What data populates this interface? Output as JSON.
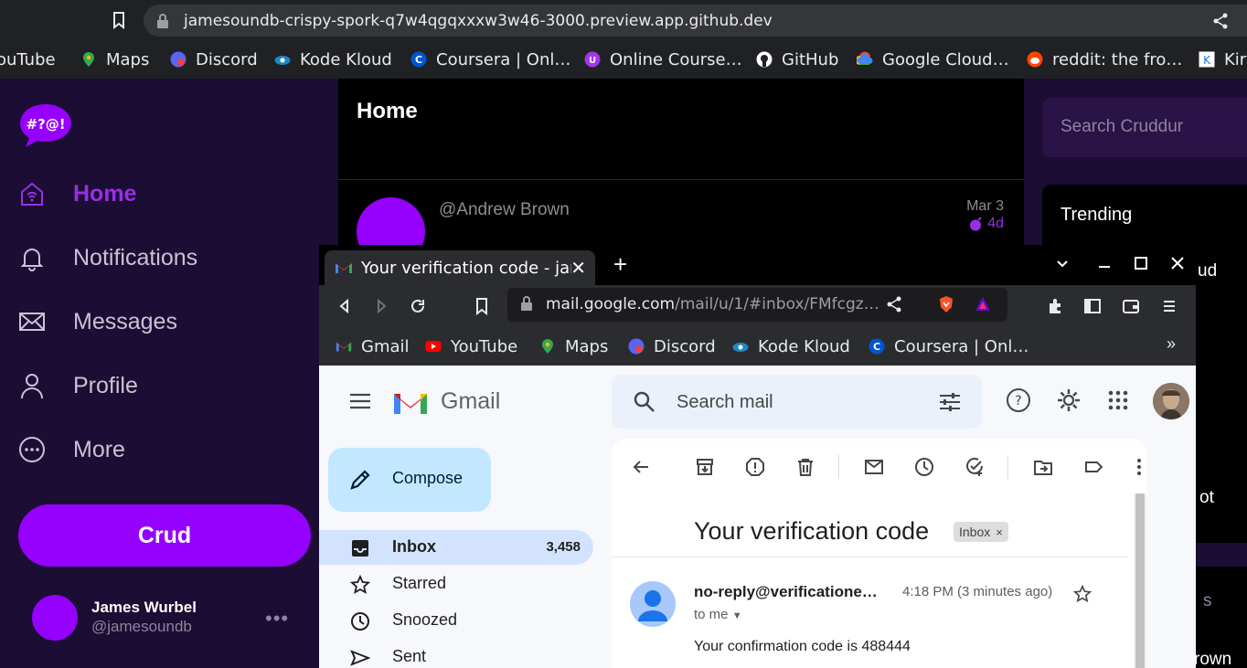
{
  "outer_browser": {
    "url": "jamesoundb-crispy-spork-q7w4qgqxxxw3w46-3000.preview.app.github.dev",
    "bookmarks": [
      {
        "label": "ouTube",
        "icon": "youtube-icon"
      },
      {
        "label": "Maps",
        "icon": "maps-icon"
      },
      {
        "label": "Discord",
        "icon": "discord-icon"
      },
      {
        "label": "Kode Kloud",
        "icon": "kodekloud-icon"
      },
      {
        "label": "Coursera | Onl…",
        "icon": "coursera-icon"
      },
      {
        "label": "Online Course…",
        "icon": "udemy-icon"
      },
      {
        "label": "GitHub",
        "icon": "github-icon"
      },
      {
        "label": "Google Cloud…",
        "icon": "google-cloud-icon"
      },
      {
        "label": "reddit: the fro…",
        "icon": "reddit-icon"
      },
      {
        "label": "Kir",
        "icon": "kirby-icon"
      }
    ]
  },
  "cruddur": {
    "logo_text": "#?@!",
    "nav": [
      {
        "label": "Home",
        "icon": "home-icon",
        "active": true
      },
      {
        "label": "Notifications",
        "icon": "bell-icon"
      },
      {
        "label": "Messages",
        "icon": "envelope-icon"
      },
      {
        "label": "Profile",
        "icon": "person-icon"
      },
      {
        "label": "More",
        "icon": "more-icon"
      }
    ],
    "crud_button": "Crud",
    "user": {
      "name": "James Wurbel",
      "handle": "@jamesoundb",
      "more": "•••"
    },
    "main": {
      "title": "Home",
      "post": {
        "author": "@Andrew Brown",
        "date": "Mar 3",
        "expires": "4d"
      }
    },
    "search_placeholder": "Search Cruddur",
    "trending_title": "Trending",
    "peek": {
      "a": "ud",
      "b": "ot",
      "c": "s",
      "d": "rown"
    }
  },
  "inner_browser": {
    "tab_title": "Your verification code - jar",
    "new_tab": "+",
    "url_host": "mail.google.com",
    "url_path": "/mail/u/1/#inbox/FMfcgz…",
    "bookmarks": [
      {
        "label": "Gmail",
        "icon": "gmail-icon"
      },
      {
        "label": "YouTube",
        "icon": "youtube-icon"
      },
      {
        "label": "Maps",
        "icon": "maps-icon"
      },
      {
        "label": "Discord",
        "icon": "discord-icon"
      },
      {
        "label": "Kode Kloud",
        "icon": "kodekloud-icon"
      },
      {
        "label": "Coursera | Onl…",
        "icon": "coursera-icon"
      }
    ],
    "bookmarks_overflow": "»"
  },
  "gmail": {
    "logo_text": "Gmail",
    "search_placeholder": "Search mail",
    "compose_label": "Compose",
    "folders": [
      {
        "label": "Inbox",
        "count": "3,458",
        "icon": "inbox-icon",
        "active": true
      },
      {
        "label": "Starred",
        "count": "",
        "icon": "star-icon"
      },
      {
        "label": "Snoozed",
        "count": "",
        "icon": "clock-icon"
      },
      {
        "label": "Sent",
        "count": "",
        "icon": "send-icon"
      }
    ],
    "email": {
      "subject": "Your verification code",
      "label_chip": "Inbox",
      "chip_close": "×",
      "sender": "no-reply@verificatione…",
      "time": "4:18 PM (3 minutes ago)",
      "to": "to me",
      "body": "Your confirmation code is 488444"
    }
  },
  "colors": {
    "cruddur_purple": "#9500ff",
    "cruddur_bg": "#1b0d33",
    "gmail_active_folder": "#d3e3fd",
    "compose_bg": "#c2e7ff"
  }
}
